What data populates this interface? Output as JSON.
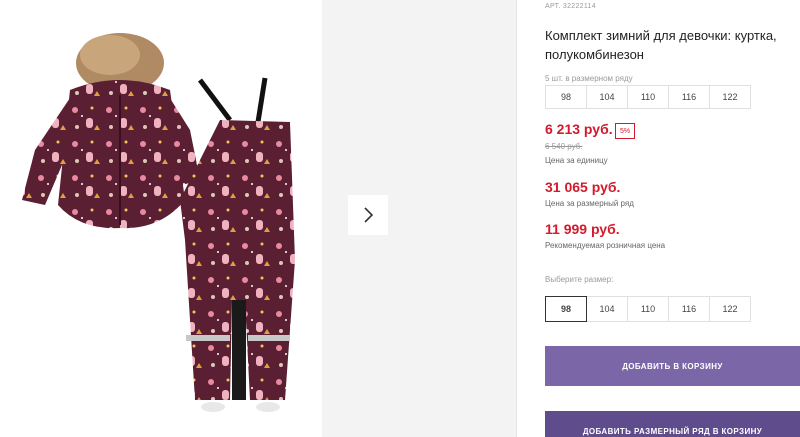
{
  "product": {
    "article": "АРТ. 32222114",
    "title": "Комплект зимний для девочки: куртка, полукомбинезон"
  },
  "size_row": {
    "label": "5 шт. в размерном ряду",
    "sizes": [
      "98",
      "104",
      "110",
      "116",
      "122"
    ]
  },
  "prices": {
    "unit_price": "6 213 руб.",
    "discount": "5%",
    "old_price": "6 540 руб.",
    "unit_caption": "Цена за единицу",
    "row_price": "31 065 руб.",
    "row_caption": "Цена за размерный ряд",
    "retail_price": "11 999 руб.",
    "retail_caption": "Рекомендуемая розничная цена"
  },
  "size_select": {
    "label": "Выберите размер:",
    "sizes": [
      "98",
      "104",
      "110",
      "116",
      "122"
    ],
    "selected": "98"
  },
  "buttons": {
    "add_to_cart": "ДОБАВИТЬ В КОРЗИНУ",
    "add_row_to_cart": "ДОБАВИТЬ РАЗМЕРНЫЙ РЯД В КОРЗИНУ"
  },
  "colors": {
    "price_red": "#d31a2c",
    "button_purple": "#7b67a8",
    "garment_burgundy": "#5a1f33"
  },
  "icons": {
    "next": "chevron-right-icon"
  }
}
